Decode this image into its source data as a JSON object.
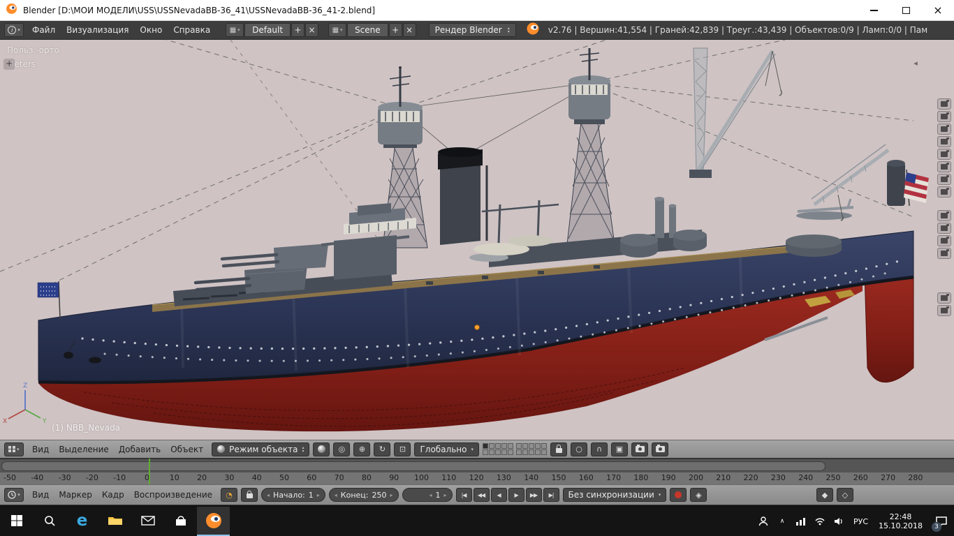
{
  "window": {
    "title": "Blender [D:\\МОИ МОДЕЛИ\\USS\\USSNevadaBB-36_41\\USSNevadaBB-36_41-2.blend]"
  },
  "info_bar": {
    "menus": [
      "Файл",
      "Визуализация",
      "Окно",
      "Справка"
    ],
    "screen_value": "Default",
    "scene_value": "Scene",
    "engine_value": "Рендер Blender",
    "stats": "v2.76 | Вершин:41,554 | Граней:42,839 | Треуг.:43,439 | Объектов:0/9 | Ламп:0/0 | Пам"
  },
  "viewport": {
    "view_label": "Польз.-орто",
    "unit_label": "Meters",
    "object_label": "(1) NBB_Nevada",
    "axis_x": "X",
    "axis_y": "Y",
    "axis_z": "Z"
  },
  "right_panel": {
    "tabs": [
      "render-tab-icon",
      "render-layers-tab-icon",
      "scene-tab-icon",
      "world-tab-icon",
      "object-tab-icon",
      "constraints-tab-icon",
      "modifiers-tab-icon",
      "object-data-tab-icon",
      "material-tab-icon",
      "texture-tab-icon",
      "particles-tab-icon",
      "physics-tab-icon",
      "grease-pencil-tab-icon",
      "history-tab-icon"
    ]
  },
  "viewport_header": {
    "menus": [
      "Вид",
      "Выделение",
      "Добавить",
      "Объект"
    ],
    "mode_value": "Режим объекта",
    "orientation_value": "Глобально"
  },
  "timeline": {
    "menus": [
      "Вид",
      "Маркер",
      "Кадр",
      "Воспроизведение"
    ],
    "start_label": "Начало:",
    "start_value": "1",
    "end_label": "Конец:",
    "end_value": "250",
    "frame_value": "1",
    "sync_value": "Без синхронизации",
    "playback": [
      "jump-start",
      "prev-keyframe",
      "play-reverse",
      "play",
      "next-keyframe",
      "jump-end"
    ],
    "ticks": [
      "-50",
      "-40",
      "-30",
      "-20",
      "-10",
      "0",
      "10",
      "20",
      "30",
      "40",
      "50",
      "60",
      "70",
      "80",
      "90",
      "100",
      "110",
      "120",
      "130",
      "140",
      "150",
      "160",
      "170",
      "180",
      "190",
      "200",
      "210",
      "220",
      "230",
      "240",
      "250",
      "260",
      "270",
      "280"
    ]
  },
  "taskbar": {
    "lang": "РУС",
    "time": "22:48",
    "date": "15.10.2018",
    "badge": "3"
  },
  "colors": {
    "accent_orange": "#ff8d2c",
    "hull_blue": "#2b3454",
    "hull_red": "#8e2019",
    "playhead_green": "#5fae33",
    "viewport_bg": "#cfc3c4"
  }
}
